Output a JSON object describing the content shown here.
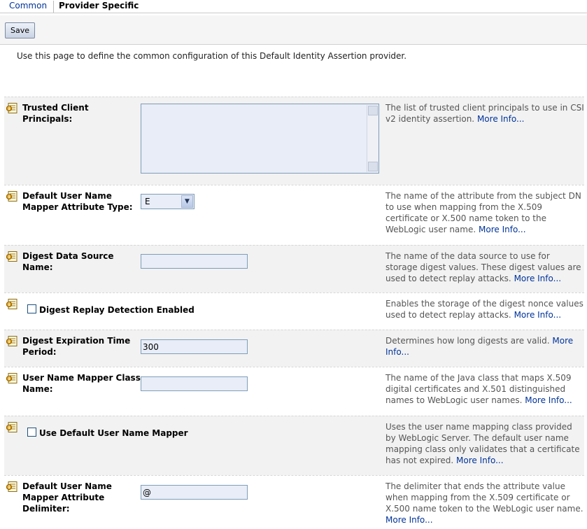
{
  "tabs": {
    "common": "Common",
    "provider_specific": "Provider Specific"
  },
  "toolbar": {
    "save_label": "Save"
  },
  "intro": "Use this page to define the common configuration of this Default Identity Assertion provider.",
  "more_info": "More Info...",
  "fields": {
    "trusted_client_principals": {
      "label": "Trusted Client Principals:",
      "value": "",
      "help": "The list of trusted client principals to use in CSI v2 identity assertion."
    },
    "default_user_name_mapper_attribute_type": {
      "label": "Default User Name Mapper Attribute Type:",
      "value": "E",
      "help": "The name of the attribute from the subject DN to use when mapping from the X.509 certificate or X.500 name token to the WebLogic user name."
    },
    "digest_data_source_name": {
      "label": "Digest Data Source Name:",
      "value": "",
      "help": "The name of the data source to use for storage digest values. These digest values are used to detect replay attacks."
    },
    "digest_replay_detection_enabled": {
      "label": "Digest Replay Detection Enabled",
      "checked": false,
      "help": "Enables the storage of the digest nonce values used to detect replay attacks."
    },
    "digest_expiration_time_period": {
      "label": "Digest Expiration Time Period:",
      "value": "300",
      "help": "Determines how long digests are valid."
    },
    "user_name_mapper_class_name": {
      "label": "User Name Mapper Class Name:",
      "value": "",
      "help": "The name of the Java class that maps X.509 digital certificates and X.501 distinguished names to WebLogic user names."
    },
    "use_default_user_name_mapper": {
      "label": "Use Default User Name Mapper",
      "checked": false,
      "help": "Uses the user name mapping class provided by WebLogic Server. The default user name mapping class only validates that a certificate has not expired."
    },
    "default_user_name_mapper_attribute_delimiter": {
      "label": "Default User Name Mapper Attribute Delimiter:",
      "value": "@",
      "help": "The delimiter that ends the attribute value when mapping from the X.509 certificate or X.500 name token to the WebLogic user name."
    }
  }
}
